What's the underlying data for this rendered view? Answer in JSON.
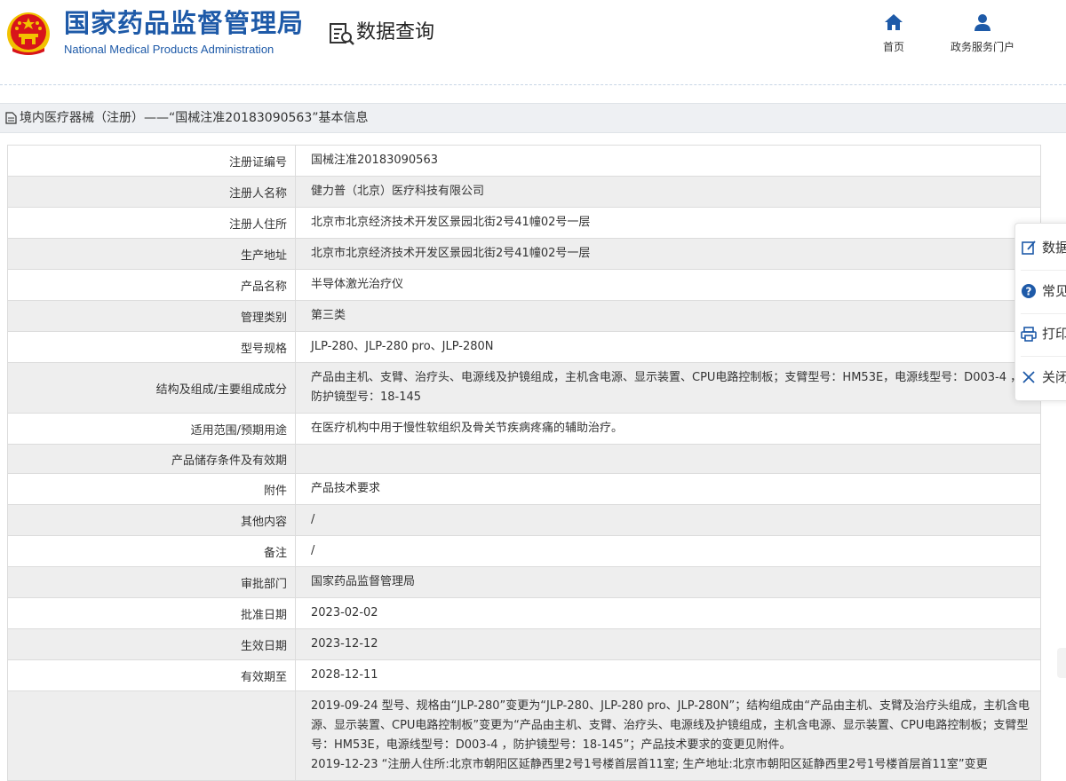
{
  "header": {
    "agency_cn": "国家药品监督管理局",
    "agency_en": "National Medical Products Administration",
    "query_title": "数据查询",
    "nav": [
      {
        "label": "首页",
        "icon": "home-icon"
      },
      {
        "label": "政务服务门户",
        "icon": "user-icon"
      }
    ]
  },
  "section": {
    "title": "境内医疗器械（注册）——“国械注准20183090563”基本信息"
  },
  "table": {
    "rows": [
      {
        "label": "注册证编号",
        "value": "国械注准20183090563"
      },
      {
        "label": "注册人名称",
        "value": "健力普（北京）医疗科技有限公司"
      },
      {
        "label": "注册人住所",
        "value": "北京市北京经济技术开发区景园北街2号41幢02号一层"
      },
      {
        "label": "生产地址",
        "value": "北京市北京经济技术开发区景园北街2号41幢02号一层"
      },
      {
        "label": "产品名称",
        "value": "半导体激光治疗仪"
      },
      {
        "label": "管理类别",
        "value": "第三类"
      },
      {
        "label": "型号规格",
        "value": "JLP-280、JLP-280 pro、JLP-280N"
      },
      {
        "label": "结构及组成/主要组成成分",
        "value": "产品由主机、支臂、治疗头、电源线及护镜组成，主机含电源、显示装置、CPU电路控制板；支臂型号：HM53E，电源线型号：D003-4 ，防护镜型号：18-145"
      },
      {
        "label": "适用范围/预期用途",
        "value": "在医疗机构中用于慢性软组织及骨关节疾病疼痛的辅助治疗。"
      },
      {
        "label": "产品储存条件及有效期",
        "value": ""
      },
      {
        "label": "附件",
        "value": "产品技术要求"
      },
      {
        "label": "其他内容",
        "value": "/"
      },
      {
        "label": "备注",
        "value": "/"
      },
      {
        "label": "审批部门",
        "value": "国家药品监督管理局"
      },
      {
        "label": "批准日期",
        "value": "2023-02-02"
      },
      {
        "label": "生效日期",
        "value": "2023-12-12"
      },
      {
        "label": "有效期至",
        "value": "2028-12-11"
      }
    ],
    "change_history": [
      "2019-09-24 型号、规格由“JLP-280”变更为“JLP-280、JLP-280 pro、JLP-280N”；结构组成由“产品由主机、支臂及治疗头组成，主机含电源、显示装置、CPU电路控制板”变更为“产品由主机、支臂、治疗头、电源线及护镜组成，主机含电源、显示装置、CPU电路控制板；支臂型号：HM53E，电源线型号：D003-4 ，防护镜型号：18-145”；产品技术要求的变更见附件。",
      "2019-12-23 “注册人住所:北京市朝阳区延静西里2号1号楼首层首11室; 生产地址:北京市朝阳区延静西里2号1号楼首层首11室”变更"
    ]
  },
  "side_panel": {
    "items": [
      {
        "label": "数据",
        "icon": "edit-icon"
      },
      {
        "label": "常见",
        "icon": "help-icon"
      },
      {
        "label": "打印",
        "icon": "print-icon"
      },
      {
        "label": "关闭",
        "icon": "close-icon"
      }
    ]
  },
  "colors": {
    "brand_blue": "#1e5aa8",
    "emblem_red": "#d8141b",
    "emblem_gold": "#f2c200",
    "row_gray": "#eeeeee",
    "border": "#dcdcdc"
  }
}
